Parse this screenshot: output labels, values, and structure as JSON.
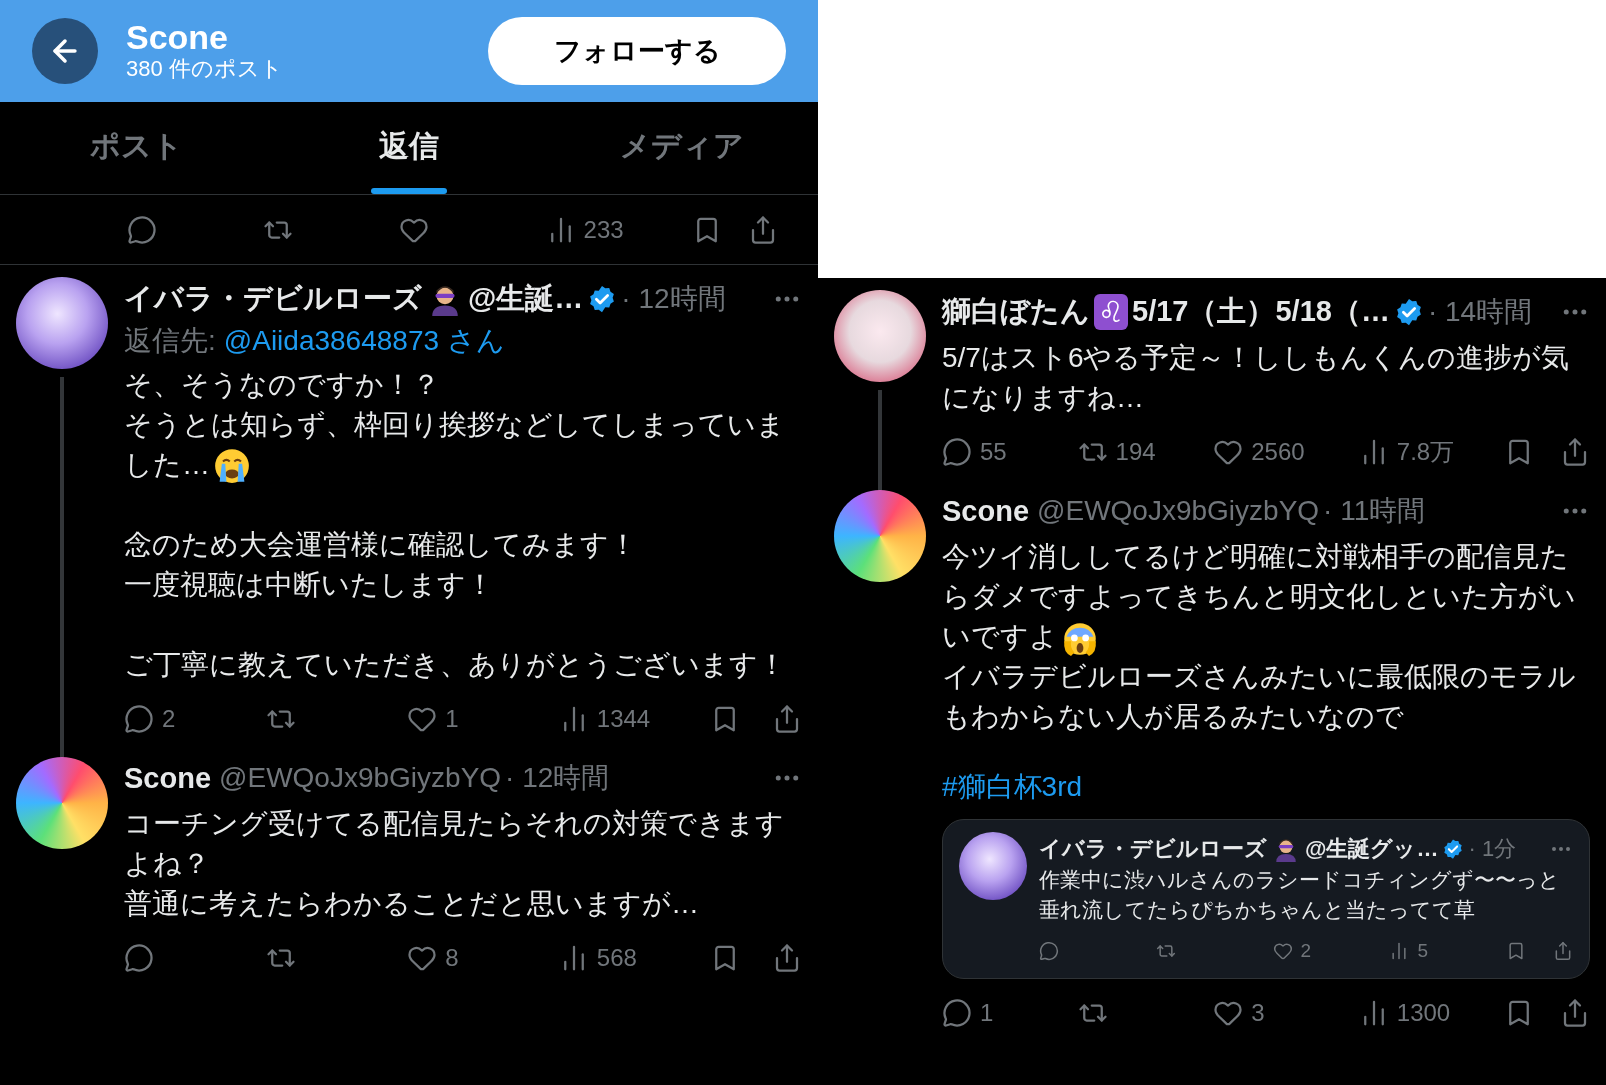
{
  "left_panel": {
    "header": {
      "title": "Scone",
      "subtitle": "380 件のポスト",
      "follow_button": "フォローする"
    },
    "tabs": [
      {
        "label": "ポスト",
        "selected": false
      },
      {
        "label": "返信",
        "selected": true
      },
      {
        "label": "メディア",
        "selected": false
      }
    ],
    "top_actions": {
      "views": "233"
    },
    "posts": [
      {
        "avatar": {
          "kind": "lilac"
        },
        "name": "イバラ・デビルローズ",
        "name_emoji": true,
        "name_suffix": "@生誕…",
        "verified": true,
        "time": "· 12時間",
        "thread_line": true,
        "reply_to": {
          "label": "返信先:",
          "handle": "@Aiida38648873 さん"
        },
        "paragraphs": [
          [
            {
              "text": "そ、そうなのですか！？"
            },
            {
              "text": "そうとは知らず、枠回り挨拶などしてしまっていました…",
              "emoji": {
                "kind": "crying"
              }
            }
          ],
          [
            {
              "text": "念のため大会運営様に確認してみます！"
            },
            {
              "text": "一度視聴は中断いたします！"
            }
          ],
          [
            {
              "text": "ご丁寧に教えていただき、ありがとうございます！"
            }
          ]
        ],
        "actions": {
          "reply": "2",
          "like": "1",
          "views": "1344"
        }
      },
      {
        "avatar": {
          "kind": "bomb"
        },
        "name": "Scone",
        "handle": "@EWQoJx9bGiyzbYQ",
        "verified": false,
        "time": "· 12時間",
        "thread_line": false,
        "paragraphs": [
          [
            {
              "text": "コーチング受けてる配信見たらそれの対策できますよね？"
            },
            {
              "text": "普通に考えたらわかることだと思いますが…"
            }
          ]
        ],
        "actions": {
          "like": "8",
          "views": "568"
        }
      }
    ]
  },
  "right_panel": {
    "posts": [
      {
        "avatar": {
          "kind": "white"
        },
        "name": "獅白ぼたん",
        "name_badge": "♌",
        "name_suffix": "5/17（土）5/18（…",
        "verified": true,
        "time": "· 14時間",
        "thread_line": true,
        "paragraphs": [
          [
            {
              "text": "5/7はスト6やる予定～！ししもんくんの進捗が気になりますね…"
            }
          ]
        ],
        "actions": {
          "reply": "55",
          "repost": "194",
          "like": "2560",
          "views": "7.8万"
        }
      },
      {
        "avatar": {
          "kind": "bomb"
        },
        "name": "Scone",
        "handle": "@EWQoJx9bGiyzbYQ",
        "verified": false,
        "time": "· 11時間",
        "thread_line": false,
        "paragraphs": [
          [
            {
              "text": "今ツイ消ししてるけど明確に対戦相手の配信見たらダメですよってきちんと明文化しといた方がいいですよ",
              "emoji": {
                "kind": "screaming"
              }
            },
            {
              "text": "イバラデビルローズさんみたいに最低限のモラルもわからない人が居るみたいなので"
            }
          ]
        ],
        "hashtag": "#獅白杯3rd",
        "quote": {
          "avatar": {
            "kind": "lilac"
          },
          "name": "イバラ・デビルローズ",
          "name_emoji": true,
          "name_suffix": "@生誕グッ…",
          "verified": true,
          "time": "· 1分",
          "text": "作業中に渋ハルさんのラシードコチィングず〜〜っと垂れ流してたらぴちかちゃんと当たってて草",
          "actions": {
            "like": "2",
            "views": "5"
          }
        },
        "actions": {
          "reply": "1",
          "like": "3",
          "views": "1300"
        }
      }
    ]
  }
}
